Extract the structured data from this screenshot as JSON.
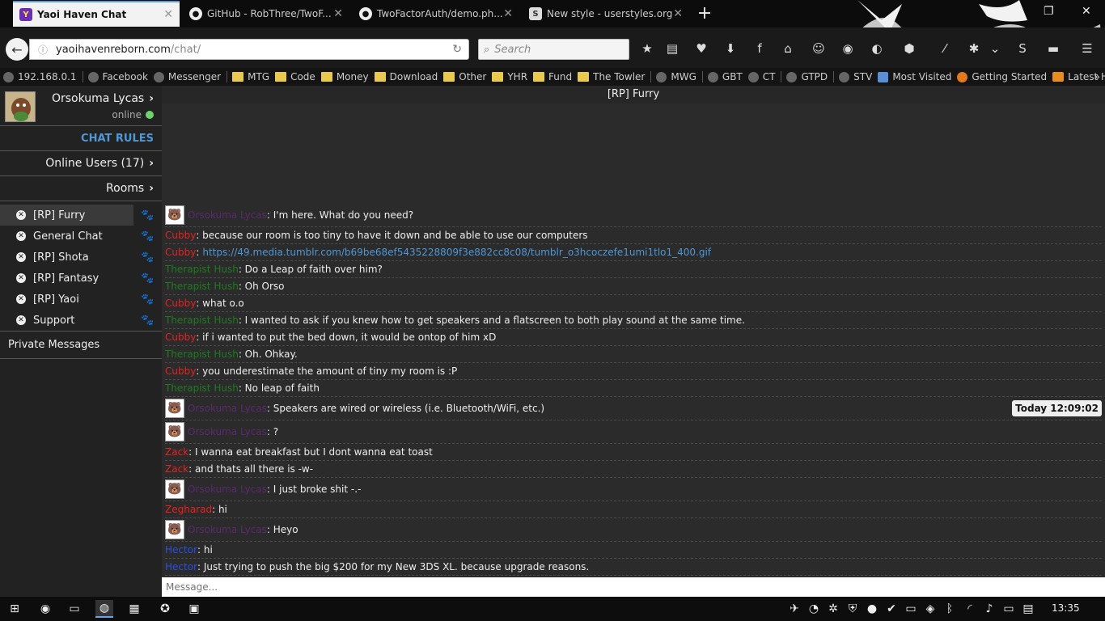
{
  "browser": {
    "tabs": [
      {
        "title": "Yaoi Haven Chat",
        "favicon": "Y"
      },
      {
        "title": "GitHub - RobThree/TwoF...",
        "favicon": "github-icon"
      },
      {
        "title": "TwoFactorAuth/demo.ph...",
        "favicon": "github-icon"
      },
      {
        "title": "New style - userstyles.org",
        "favicon": "S"
      }
    ],
    "url_host": "yaoihavenreborn.com",
    "url_path": "/chat/",
    "search_placeholder": "Search",
    "bookmarks": [
      "192.168.0.1",
      "Facebook",
      "Messenger",
      "MTG",
      "Code",
      "Money",
      "Download",
      "Other",
      "YHR",
      "Fund",
      "The Towler",
      "MWG",
      "GBT",
      "CT",
      "GTPD",
      "STV",
      "Most Visited",
      "Getting Started",
      "Latest Headlines"
    ]
  },
  "sidebar": {
    "username": "Orsokuma Lycas",
    "status": "online",
    "chat_rules": "CHAT RULES",
    "online_users": "Online Users (17)",
    "rooms_label": "Rooms",
    "rooms": [
      "[RP] Furry",
      "General Chat",
      "[RP] Shota",
      "[RP] Fantasy",
      "[RP] Yaoi",
      "Support"
    ],
    "private_messages": "Private Messages"
  },
  "chat": {
    "room_title": "[RP] Furry",
    "input_placeholder": "Message...",
    "timestamp": "Today 12:09:02",
    "messages": [
      {
        "nick": "Orsokuma Lycas",
        "text": ": I'm here. What do you need?"
      },
      {
        "nick": "Cubby",
        "text": ": because our room is too tiny to have it down and be able to use our computers"
      },
      {
        "nick": "Cubby",
        "text": ":",
        "link": "https://49.media.tumblr.com/b69be68ef5435228809f3e882cc8c08/tumblr_o3hcoczefe1umi1tlo1_400.gif"
      },
      {
        "nick": "Therapist Hush",
        "text": ": Do a Leap of faith over him?"
      },
      {
        "nick": "Therapist Hush",
        "text": ": Oh Orso"
      },
      {
        "nick": "Cubby",
        "text": ": what o.o"
      },
      {
        "nick": "Therapist Hush",
        "text": ": I wanted to ask if you knew how to get speakers and a flatscreen to both play sound at the same time."
      },
      {
        "nick": "Cubby",
        "text": ": if i wanted to put the bed down, it would be ontop of him xD"
      },
      {
        "nick": "Therapist Hush",
        "text": ": Oh. Ohkay."
      },
      {
        "nick": "Cubby",
        "text": ": you underestimate the amount of tiny my room is :P"
      },
      {
        "nick": "Therapist Hush",
        "text": ": No leap of faith"
      },
      {
        "nick": "Orsokuma Lycas",
        "text": ": Speakers are wired or wireless (i.e. Bluetooth/WiFi, etc.)"
      },
      {
        "nick": "Orsokuma Lycas",
        "text": ": ?"
      },
      {
        "nick": "Zack",
        "text": ": I wanna eat breakfast but I dont wanna eat toast"
      },
      {
        "nick": "Zack",
        "text": ": and thats all there is -w-"
      },
      {
        "nick": "Orsokuma Lycas",
        "text": ": I just broke shit -.-"
      },
      {
        "nick": "Zegharad",
        "text": ": hi"
      },
      {
        "nick": "Orsokuma Lycas",
        "text": ": Heyo"
      },
      {
        "nick": "Hector",
        "text": ": hi"
      },
      {
        "nick": "Hector",
        "text": ": Just trying to push the big $200 for my New 3DS XL. because upgrade reasons."
      }
    ]
  },
  "taskbar": {
    "clock": "13:35"
  }
}
